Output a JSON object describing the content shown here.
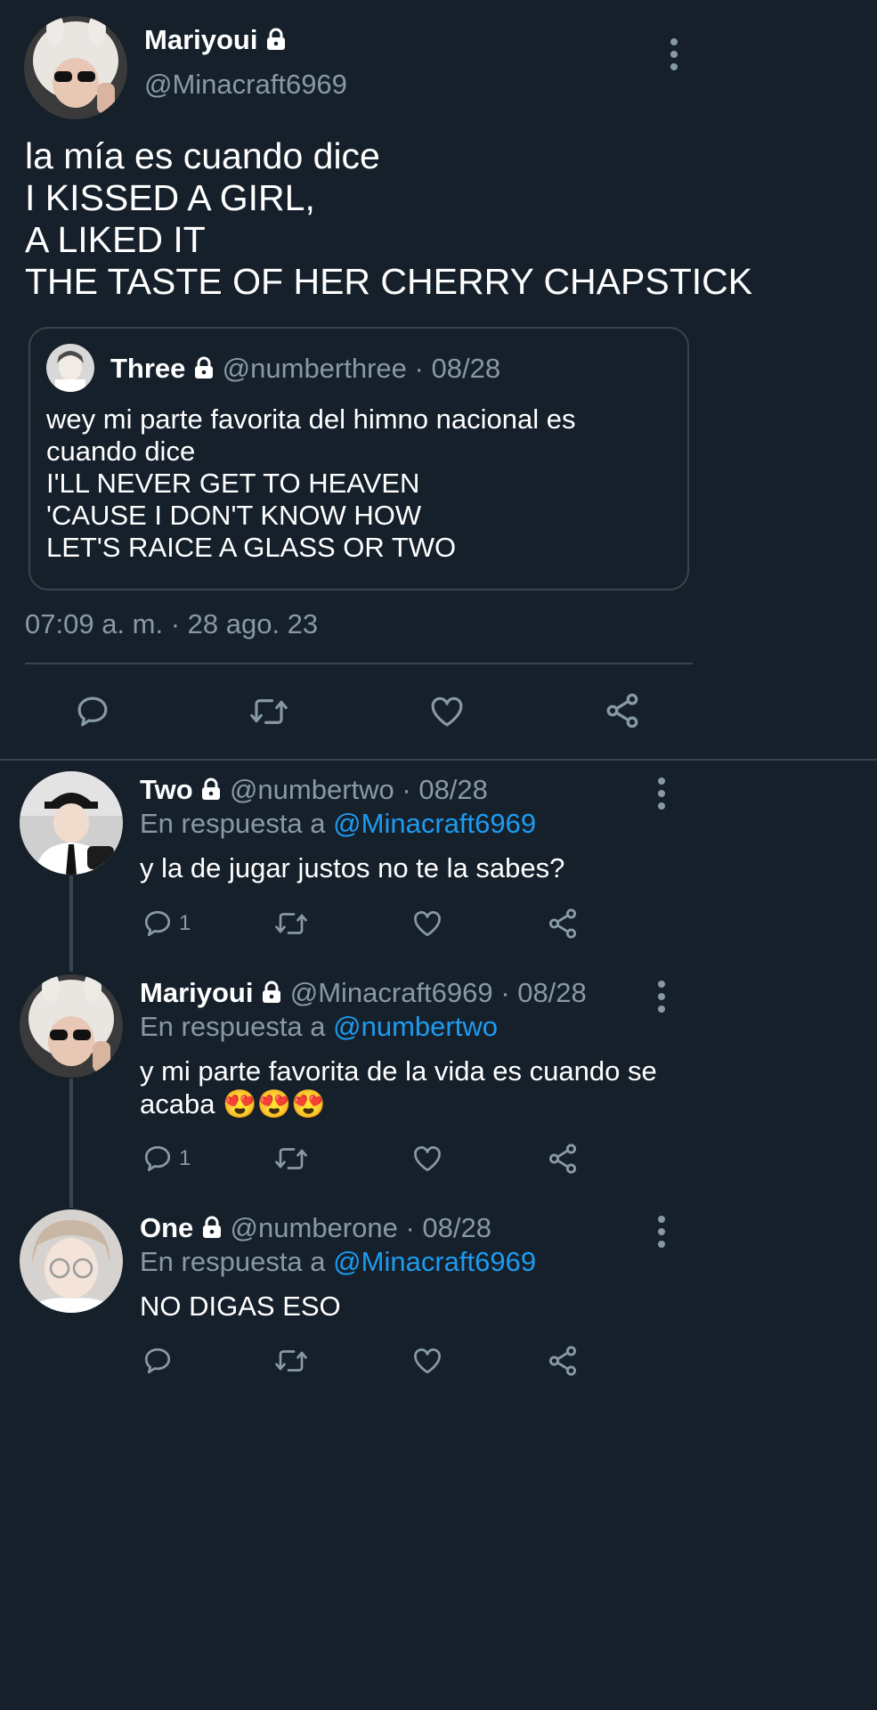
{
  "main_tweet": {
    "display_name": "Mariyoui",
    "handle": "@Minacraft6969",
    "text_lines": [
      "la mía es cuando dice",
      "I KISSED A GIRL,",
      "A LIKED IT",
      "THE TASTE OF HER CHERRY CHAPSTICK"
    ],
    "quote": {
      "display_name": "Three",
      "handle": "@numberthree",
      "date": "· 08/28",
      "text_lines": [
        "wey mi parte favorita del himno nacional es",
        "cuando dice",
        "I'LL NEVER GET TO HEAVEN",
        "'CAUSE I DON'T KNOW HOW",
        "LET'S RAICE A GLASS OR TWO"
      ]
    },
    "timestamp": "07:09 a. m. · 28 ago. 23"
  },
  "replies": [
    {
      "display_name": "Two",
      "handle": "@numbertwo",
      "date": "· 08/28",
      "reply_prefix": "En respuesta a",
      "reply_to": "@Minacraft6969",
      "text_lines": [
        "y la de jugar justos no te la sabes?"
      ],
      "reply_count": "1"
    },
    {
      "display_name": "Mariyoui",
      "handle": "@Minacraft6969",
      "date": "· 08/28",
      "reply_prefix": "En respuesta a",
      "reply_to": "@numbertwo",
      "text_lines": [
        "y mi parte favorita de la vida es cuando se",
        "acaba"
      ],
      "emoji": "😍😍😍",
      "reply_count": "1"
    },
    {
      "display_name": "One",
      "handle": "@numberone",
      "date": "· 08/28",
      "reply_prefix": "En respuesta a",
      "reply_to": "@Minacraft6969",
      "text_lines": [
        "NO DIGAS ESO"
      ],
      "reply_count": ""
    }
  ],
  "icons": {
    "reply": "reply-icon",
    "retweet": "retweet-icon",
    "like": "like-icon",
    "share": "share-icon",
    "lock": "lock-icon",
    "more": "more-options-icon"
  },
  "colors": {
    "background": "#15202b",
    "text": "#ffffff",
    "muted": "#8899a6",
    "link": "#1d9bf0",
    "divider": "#38444d"
  }
}
